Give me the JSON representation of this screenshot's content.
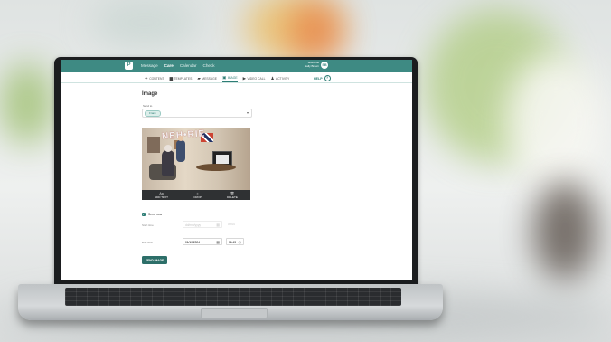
{
  "app": {
    "logo_glyph": "P",
    "top_nav": [
      "Message",
      "Care",
      "Calendar",
      "Check"
    ],
    "active_top": "Care",
    "user_line1": "Welcome",
    "user_line2": "Sally Brown",
    "avatar": "SB"
  },
  "tabs": [
    {
      "label": "CONTENT",
      "icon": "paper-plane-icon"
    },
    {
      "label": "TEMPLATES",
      "icon": "folder-icon"
    },
    {
      "label": "MESSAGE",
      "icon": "chat-icon"
    },
    {
      "label": "IMAGE",
      "icon": "image-icon",
      "active": true
    },
    {
      "label": "VIDEO CALL",
      "icon": "video-icon"
    },
    {
      "label": "ACTIVITY",
      "icon": "bell-icon"
    }
  ],
  "help": {
    "label": "HELP",
    "glyph": "?"
  },
  "page": {
    "title": "Image",
    "recipient_label": "Send to",
    "recipient_chip": "Frank",
    "photo_banner": "NEH•RIE",
    "tools": [
      {
        "label": "ADD TEXT",
        "icon": "text-icon",
        "glyph": "Aa"
      },
      {
        "label": "CROP",
        "icon": "crop-icon",
        "glyph": "⌗"
      },
      {
        "label": "DELETE",
        "icon": "trash-icon",
        "glyph": "🗑"
      }
    ],
    "send_now_label": "Send now",
    "start_label": "Start time",
    "start_date": "dd/mm/yyyy",
    "start_time": "00:00",
    "end_label": "End time",
    "end_date": "01/10/2024",
    "end_time": "16:43",
    "send_button": "SEND IMAGE"
  },
  "colors": {
    "brand": "#3e8a83",
    "brand_dark": "#2d6f69"
  }
}
